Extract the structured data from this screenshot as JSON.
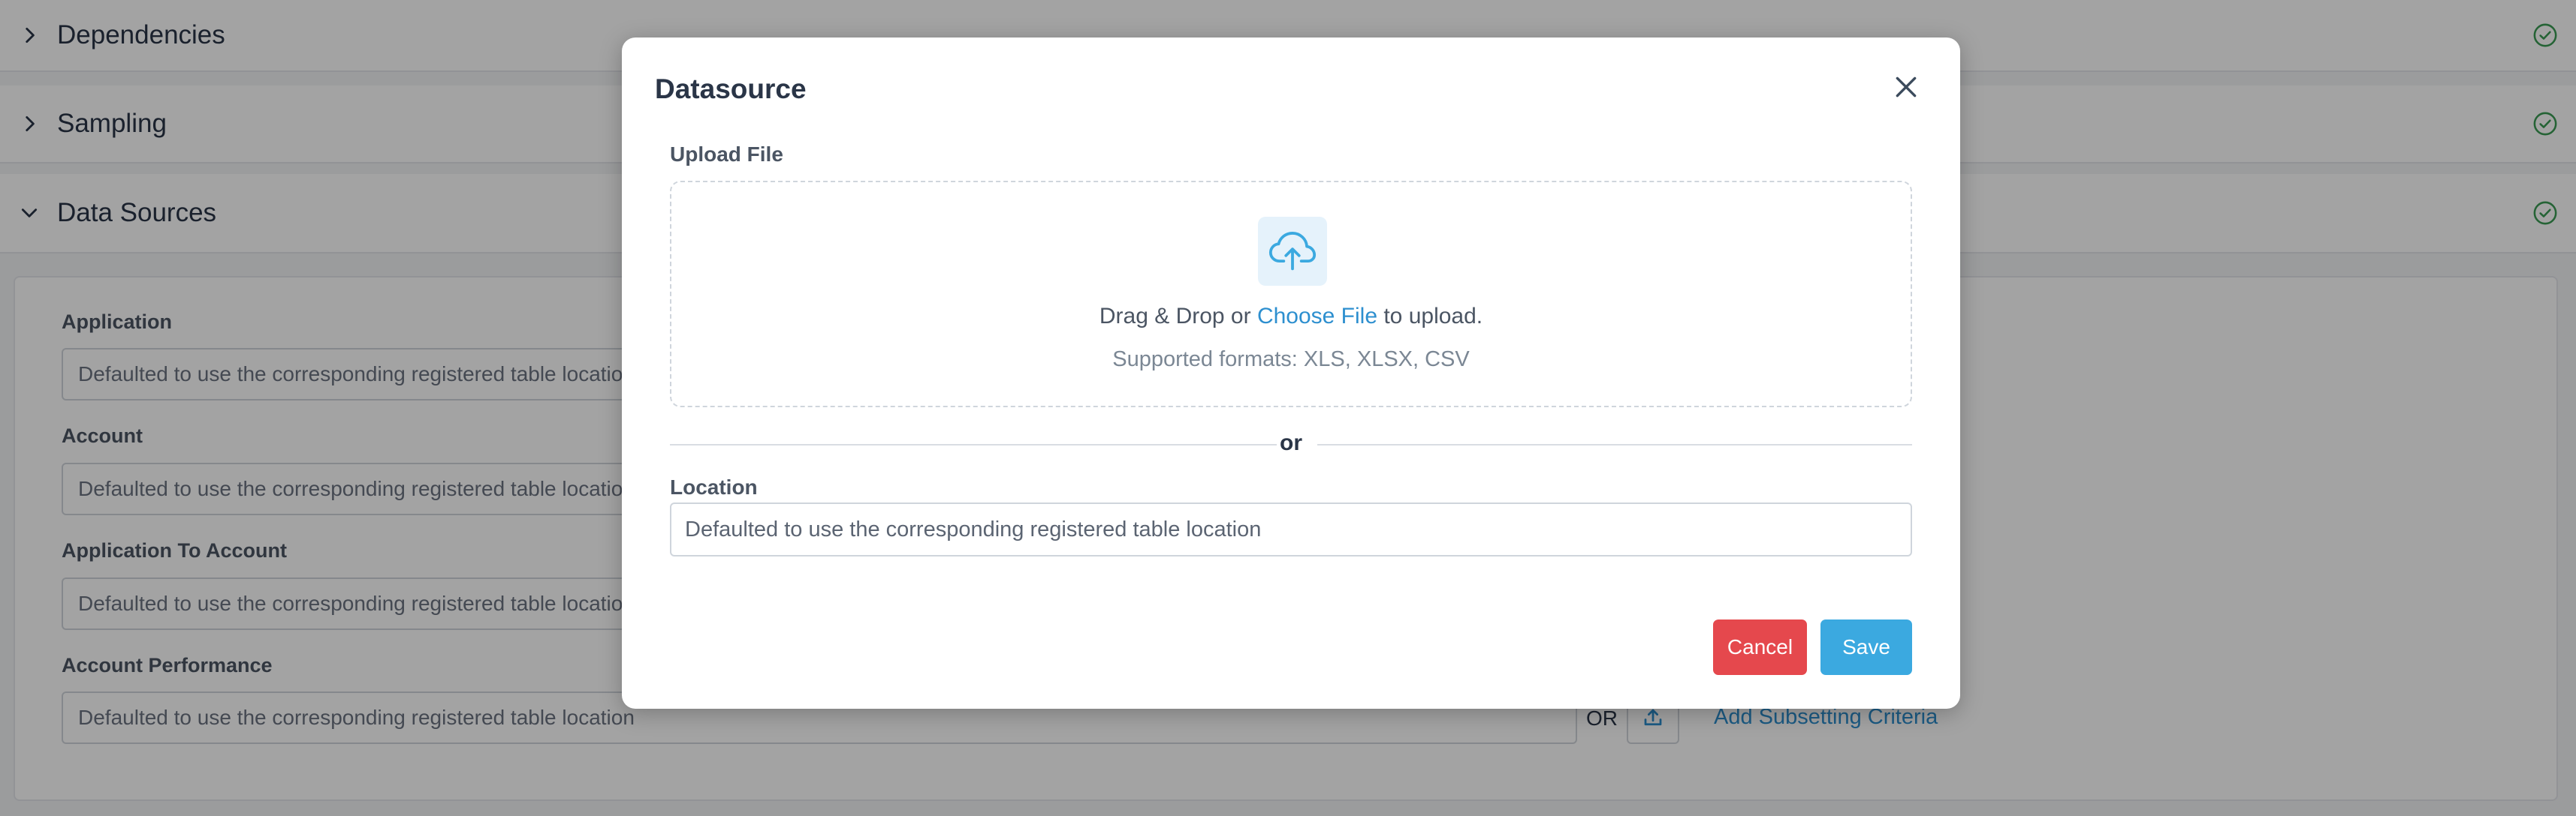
{
  "background": {
    "sections": [
      {
        "title": "Dependencies",
        "expanded": false
      },
      {
        "title": "Sampling",
        "expanded": false
      },
      {
        "title": "Data Sources",
        "expanded": true
      }
    ],
    "datasources": [
      {
        "label": "Application",
        "placeholder": "Defaulted to use the corresponding registered table location"
      },
      {
        "label": "Account",
        "placeholder": "Defaulted to use the corresponding registered table location"
      },
      {
        "label": "Application To Account",
        "placeholder": "Defaulted to use the corresponding registered table location"
      },
      {
        "label": "Account Performance",
        "placeholder": "Defaulted to use the corresponding registered table location"
      }
    ],
    "or_label": "OR",
    "subsetting_link": "Add Subsetting Criteria"
  },
  "modal": {
    "title": "Datasource",
    "upload_label": "Upload File",
    "drop_prefix": "Drag & Drop or ",
    "choose_file": "Choose File",
    "drop_suffix": " to upload.",
    "formats": "Supported formats: XLS, XLSX, CSV",
    "divider_or": "or",
    "location_label": "Location",
    "location_placeholder": "Defaulted to use the corresponding registered table location",
    "cancel_label": "Cancel",
    "save_label": "Save"
  },
  "colors": {
    "accent_blue": "#3ba9e0",
    "link_blue": "#2d8fcf",
    "danger_red": "#e5484d",
    "success_green": "#3a9b54"
  }
}
